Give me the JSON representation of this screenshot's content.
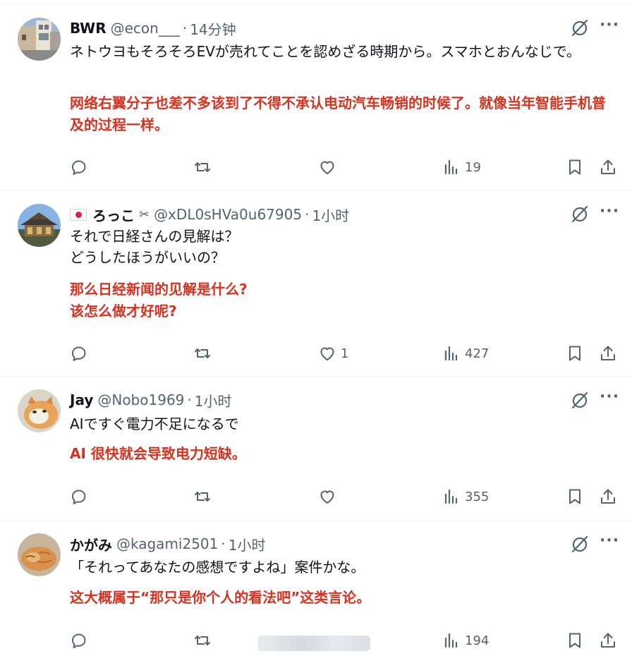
{
  "tweets": [
    {
      "name": "BWR",
      "handle": "@econ___",
      "time": "14分钟",
      "jp_lines": [
        "ネトウヨもそろそろEVが売れてことを認めざる時期から。スマホとおんなじで。"
      ],
      "cn_lines": [
        "网络右翼分子也差不多该到了不得不承认电动汽车畅销的时候了。就像当年智能手机普及的过程一样。"
      ],
      "replies": "",
      "retweets": "",
      "likes": "",
      "views": "19",
      "avatar_icon": "street-photo-avatar"
    },
    {
      "name": "ろっこ",
      "handle": "@xDL0sHVa0u67905",
      "time": "1小时",
      "jp_lines": [
        "それで日経さんの見解は？",
        "どうしたほうがいいの？"
      ],
      "cn_lines": [
        "那么日经新闻的见解是什么?",
        "该怎么做才好呢?"
      ],
      "replies": "",
      "retweets": "",
      "likes": "1",
      "views": "427",
      "avatar_icon": "temple-photo-avatar"
    },
    {
      "name": "Jay",
      "handle": "@Nobo1969",
      "time": "1小时",
      "jp_lines": [
        "AIですぐ電力不足になるで"
      ],
      "cn_lines": [
        "AI 很快就会导致电力短缺。"
      ],
      "replies": "",
      "retweets": "",
      "likes": "",
      "views": "355",
      "avatar_icon": "cat-photo-avatar"
    },
    {
      "name": "かがみ",
      "handle": "@kagami2501",
      "time": "1小时",
      "jp_lines": [
        "「それってあなたの感想ですよね」案件かな。"
      ],
      "cn_lines": [
        "这大概属于“那只是你个人的看法吧”这类言论。"
      ],
      "replies": "",
      "retweets": "",
      "likes": "",
      "views": "194",
      "avatar_icon": "sleeping-cat-avatar"
    }
  ],
  "separator": "·",
  "more_label": "···",
  "colors": {
    "translation_red": "#d6321f",
    "muted_gray": "#536471",
    "divider": "#eff3f4"
  }
}
